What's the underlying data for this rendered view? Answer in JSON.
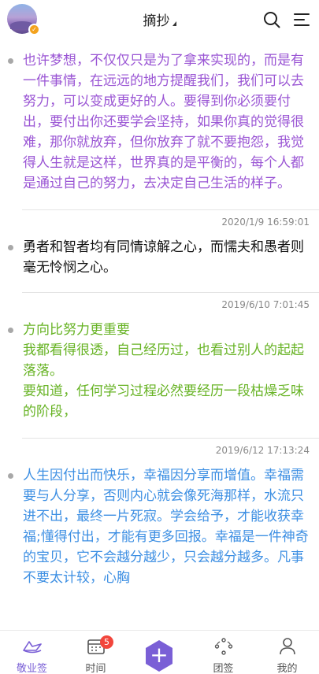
{
  "header": {
    "title": "摘抄",
    "icons": {
      "avatar_badge": "verified-badge",
      "search": "search-icon",
      "menu": "menu-icon"
    }
  },
  "entries": [
    {
      "text": "也许梦想，不仅仅只是为了拿来实现的，而是有一件事情，在远远的地方提醒我们，我们可以去努力，可以变成更好的人。要得到你必须要付出，要付出你还要学会坚持，如果你真的觉得很难，那你就放弃，但你放弃了就不要抱怨，我觉得人生就是这样，世界真的是平衡的，每个人都是通过自己的努力，去决定自己生活的样子。",
      "color": "#9a55d4",
      "timestamp": "2020/1/9 16:59:01"
    },
    {
      "text": "勇者和智者均有同情谅解之心，而懦夫和愚者则毫无怜悯之心。",
      "color": "#111111",
      "timestamp": "2019/6/10 7:01:45"
    },
    {
      "text": "方向比努力更重要\n我都看得很透，自己经历过，也看过别人的起起落落。\n要知道，任何学习过程必然要经历一段枯燥乏味的阶段，",
      "color": "#67b324",
      "timestamp": "2019/6/12 17:13:24"
    },
    {
      "text": "人生因付出而快乐，幸福因分享而增值。幸福需要与人分享，否则内心就会像死海那样，水流只进不出，最终一片死寂。学会给予，才能收获幸福;懂得付出，才能有更多回报。幸福是一件神奇的宝贝，它不会越分越少，只会越分越多。凡事不要太计较，心胸",
      "color": "#3d8fe3",
      "timestamp": ""
    }
  ],
  "tabbar": {
    "tabs": [
      {
        "label": "敬业签",
        "icon": "paper-boat-icon"
      },
      {
        "label": "时间",
        "icon": "calendar-icon",
        "badge": "5"
      },
      {
        "label": "",
        "icon": "plus-icon"
      },
      {
        "label": "团签",
        "icon": "team-icon"
      },
      {
        "label": "我的",
        "icon": "user-icon"
      }
    ],
    "accent": "#7a5fd6"
  }
}
